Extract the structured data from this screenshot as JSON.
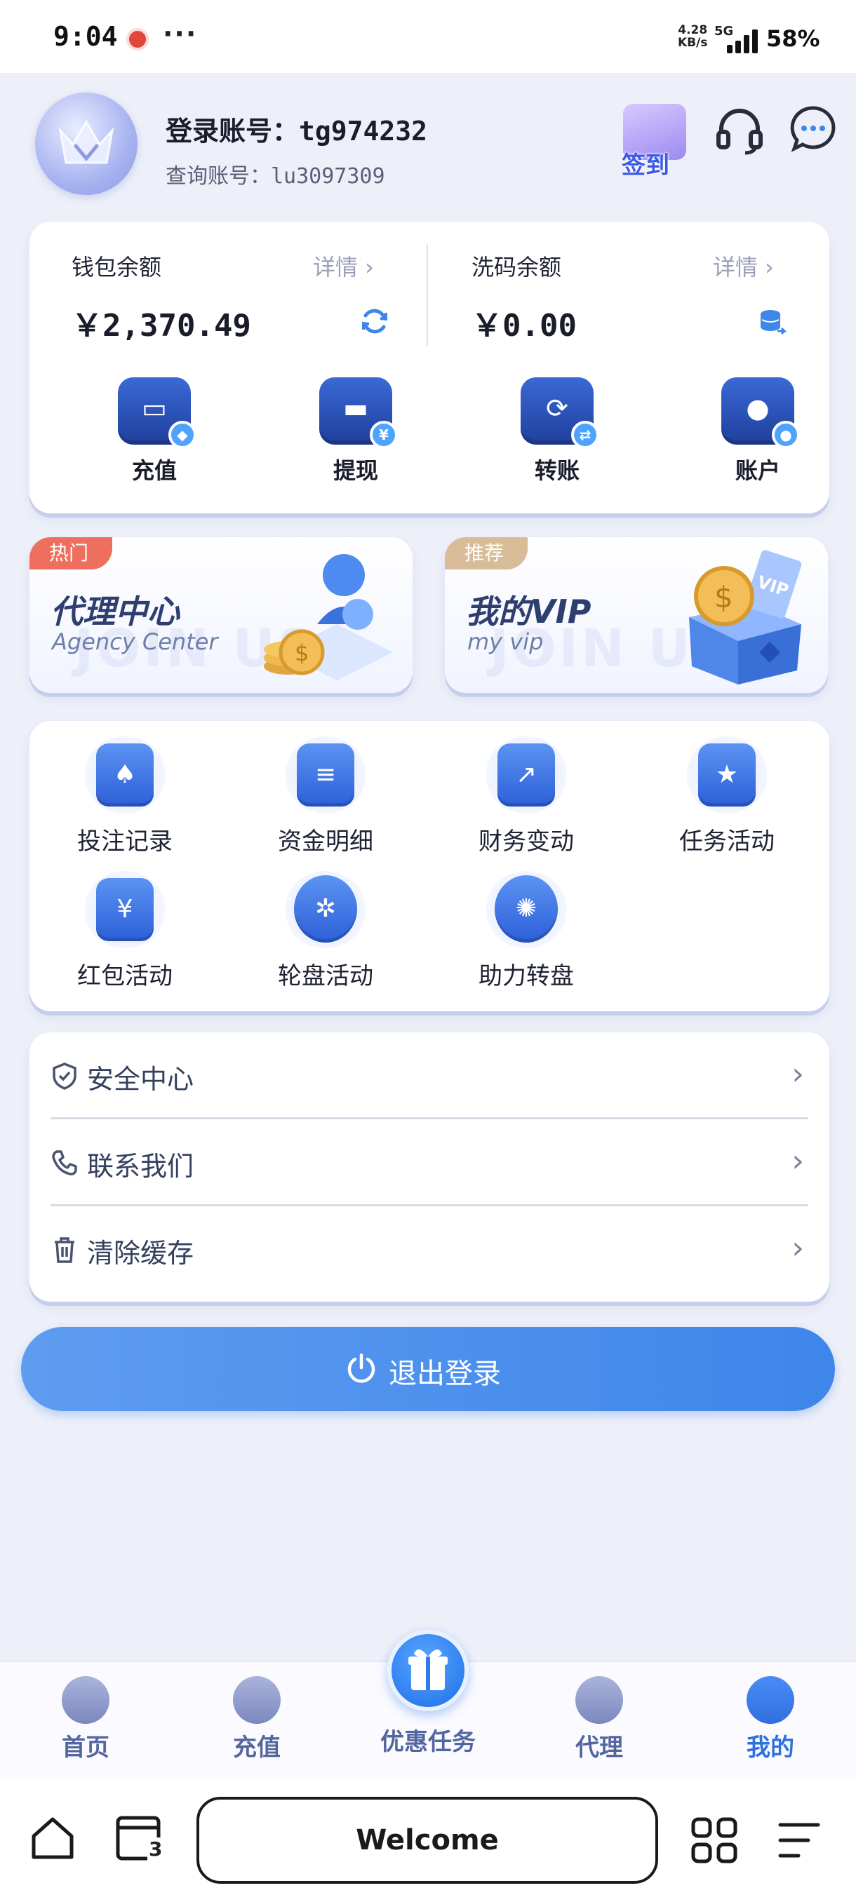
{
  "status_bar": {
    "time": "9:04",
    "dots": "···",
    "net_speed": "4.28\nKB/s",
    "net_type": "5G",
    "battery": "58%"
  },
  "profile": {
    "login_label": "登录账号：",
    "login_id": "tg974232",
    "query_label": "查询账号：",
    "query_id": "lu3097309",
    "signin_label": "签到"
  },
  "wallet": {
    "wallet_label": "钱包余额",
    "wallet_detail": "详情 ›",
    "wallet_amount": "￥2,370.49",
    "wash_label": "洗码余额",
    "wash_detail": "详情 ›",
    "wash_amount": "￥0.00",
    "actions": [
      {
        "label": "充值",
        "icon": "wallet-icon"
      },
      {
        "label": "提现",
        "icon": "card-icon"
      },
      {
        "label": "转账",
        "icon": "transfer-icon"
      },
      {
        "label": "账户",
        "icon": "account-icon"
      }
    ]
  },
  "promos": [
    {
      "tag": "热门",
      "title": "代理中心",
      "subtitle": "Agency Center",
      "ghost": "JOIN US",
      "tag_color": "#ef6f5e"
    },
    {
      "tag": "推荐",
      "title": "我的VIP",
      "subtitle": "my vip",
      "ghost": "JOIN US",
      "tag_color": "#d8bc98"
    }
  ],
  "features": [
    {
      "label": "投注记录",
      "glyph": "♠"
    },
    {
      "label": "资金明细",
      "glyph": "≡"
    },
    {
      "label": "财务变动",
      "glyph": "↗"
    },
    {
      "label": "任务活动",
      "glyph": "★"
    },
    {
      "label": "红包活动",
      "glyph": "¥"
    },
    {
      "label": "轮盘活动",
      "glyph": "✲"
    },
    {
      "label": "助力转盘",
      "glyph": "✺"
    }
  ],
  "menu": [
    {
      "label": "安全中心",
      "icon": "shield-check-icon"
    },
    {
      "label": "联系我们",
      "icon": "phone-icon"
    },
    {
      "label": "清除缓存",
      "icon": "trash-icon"
    }
  ],
  "logout_label": "退出登录",
  "tabs": [
    {
      "label": "首页",
      "icon": "home-icon"
    },
    {
      "label": "充值",
      "icon": "deposit-icon"
    },
    {
      "label": "优惠任务",
      "icon": "gift-icon"
    },
    {
      "label": "代理",
      "icon": "agent-icon"
    },
    {
      "label": "我的",
      "icon": "user-icon"
    }
  ],
  "active_tab": "我的",
  "nav": {
    "tab_count": "3",
    "welcome": "Welcome"
  },
  "colors": {
    "accent": "#3e86ea",
    "background": "#eef0f9"
  }
}
